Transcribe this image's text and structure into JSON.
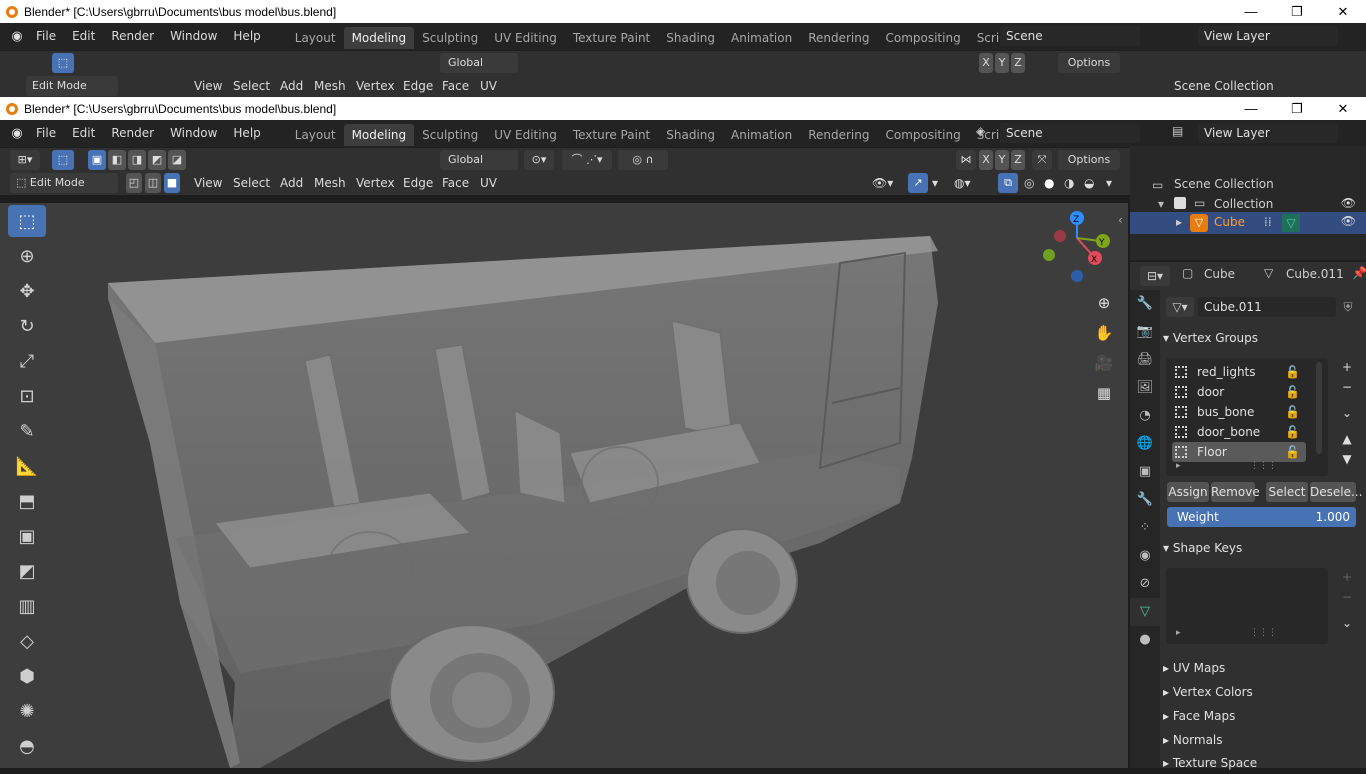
{
  "window": {
    "title": "Blender* [C:\\Users\\gbrru\\Documents\\bus model\\bus.blend]",
    "minimize": "—",
    "maximize": "❐",
    "close": "✕"
  },
  "menu": [
    "File",
    "Edit",
    "Render",
    "Window",
    "Help"
  ],
  "workspaces": [
    "Layout",
    "Modeling",
    "Sculpting",
    "UV Editing",
    "Texture Paint",
    "Shading",
    "Animation",
    "Rendering",
    "Compositing",
    "Scripting"
  ],
  "active_workspace": "Modeling",
  "add_tab": "+",
  "scene": {
    "label": "Scene"
  },
  "view_layer": {
    "label": "View Layer"
  },
  "tool_header": {
    "transform_orientation": "Global",
    "options": "Options",
    "axes": [
      "X",
      "Y",
      "Z"
    ]
  },
  "editor_header": {
    "mode": "Edit Mode",
    "menus": [
      "View",
      "Select",
      "Add",
      "Mesh",
      "Vertex",
      "Edge",
      "Face",
      "UV"
    ]
  },
  "outliner": {
    "scene_collection": "Scene Collection",
    "collection": "Collection",
    "object": "Cube"
  },
  "properties": {
    "object_name": "Cube",
    "data_name": "Cube.011",
    "mesh_field": "Cube.011",
    "vertex_groups_title": "Vertex Groups",
    "vertex_groups": [
      "red_lights",
      "door",
      "bus_bone",
      "door_bone",
      "Floor"
    ],
    "selected_group": "Floor",
    "assign": "Assign",
    "remove": "Remove",
    "select": "Select",
    "deselect": "Desele...",
    "weight_label": "Weight",
    "weight_value": "1.000",
    "weight_fraction": 1.0,
    "shape_keys_title": "Shape Keys",
    "collapsed_panels": [
      "UV Maps",
      "Vertex Colors",
      "Face Maps",
      "Normals",
      "Texture Space"
    ]
  },
  "colors": {
    "accent": "#4772b3",
    "orange": "#e87d0d",
    "mesh_green": "#4ec8a0",
    "axis_x": "#e24a5a",
    "axis_y": "#7fa51a",
    "axis_z": "#2c8fff"
  }
}
